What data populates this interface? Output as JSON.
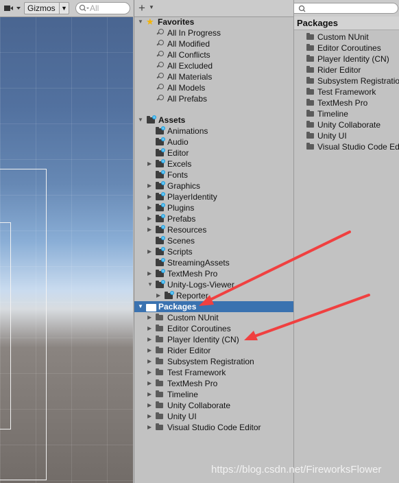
{
  "scene": {
    "gizmos_label": "Gizmos",
    "search_placeholder": "All"
  },
  "tree": {
    "favorites": {
      "label": "Favorites",
      "items": [
        "All In Progress",
        "All Modified",
        "All Conflicts",
        "All Excluded",
        "All Materials",
        "All Models",
        "All Prefabs"
      ]
    },
    "assets": {
      "label": "Assets",
      "items": [
        {
          "label": "Animations",
          "expandable": false
        },
        {
          "label": "Audio",
          "expandable": false
        },
        {
          "label": "Editor",
          "expandable": false
        },
        {
          "label": "Excels",
          "expandable": true
        },
        {
          "label": "Fonts",
          "expandable": false
        },
        {
          "label": "Graphics",
          "expandable": true
        },
        {
          "label": "PlayerIdentity",
          "expandable": true
        },
        {
          "label": "Plugins",
          "expandable": true
        },
        {
          "label": "Prefabs",
          "expandable": true
        },
        {
          "label": "Resources",
          "expandable": true
        },
        {
          "label": "Scenes",
          "expandable": false
        },
        {
          "label": "Scripts",
          "expandable": true
        },
        {
          "label": "StreamingAssets",
          "expandable": false
        },
        {
          "label": "TextMesh Pro",
          "expandable": true
        },
        {
          "label": "Unity-Logs-Viewer",
          "expandable": true,
          "expanded": true
        },
        {
          "label": "Reporter",
          "expandable": true,
          "indent": 1
        }
      ]
    },
    "packages": {
      "label": "Packages",
      "items": [
        "Custom NUnit",
        "Editor Coroutines",
        "Player Identity (CN)",
        "Rider Editor",
        "Subsystem Registration",
        "Test Framework",
        "TextMesh Pro",
        "Timeline",
        "Unity Collaborate",
        "Unity UI",
        "Visual Studio Code Editor"
      ]
    }
  },
  "right_panel": {
    "title": "Packages",
    "items": [
      "Custom NUnit",
      "Editor Coroutines",
      "Player Identity (CN)",
      "Rider Editor",
      "Subsystem Registration",
      "Test Framework",
      "TextMesh Pro",
      "Timeline",
      "Unity Collaborate",
      "Unity UI",
      "Visual Studio Code Editor"
    ]
  },
  "watermark": "https://blog.csdn.net/FireworksFlower",
  "colors": {
    "selection": "#3a72b0",
    "annotation_arrow": "#f04040"
  }
}
